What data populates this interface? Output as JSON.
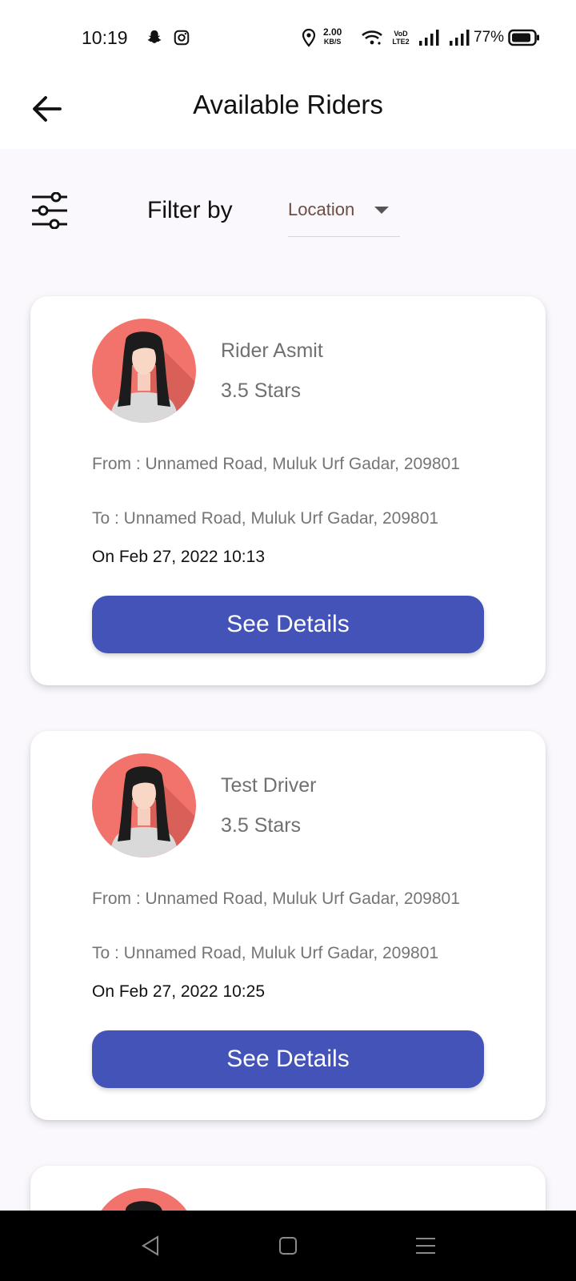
{
  "status_bar": {
    "time": "10:19",
    "speed_value": "2.00",
    "speed_unit": "KB/S",
    "network_label": "VoD LTE2",
    "battery_percent": "77%",
    "icons": [
      "snapchat-icon",
      "instagram-icon",
      "location-icon",
      "wifi-icon",
      "signal-icon",
      "signal-icon",
      "battery-icon"
    ]
  },
  "header": {
    "title": "Available Riders",
    "back_icon": "back-arrow-icon"
  },
  "filter": {
    "label": "Filter by",
    "selected": "Location",
    "icon": "filter-sliders-icon"
  },
  "riders": [
    {
      "name": "Rider Asmit",
      "rating": "3.5 Stars",
      "from": "From : Unnamed Road, Muluk Urf Gadar, 209801",
      "to": "To : Unnamed Road, Muluk Urf Gadar, 209801",
      "date": "On Feb 27, 2022 10:13",
      "button": "See Details"
    },
    {
      "name": "Test Driver",
      "rating": "3.5 Stars",
      "from": "From : Unnamed Road, Muluk Urf Gadar, 209801",
      "to": "To : Unnamed Road, Muluk Urf Gadar, 209801",
      "date": "On Feb 27, 2022 10:25",
      "button": "See Details"
    }
  ],
  "colors": {
    "accent": "#4353b8",
    "avatar_bg": "#f2736b",
    "dropdown_text": "#6d4c41"
  },
  "nav_bar": {
    "icons": [
      "back-triangle-icon",
      "home-square-icon",
      "menu-lines-icon"
    ]
  }
}
